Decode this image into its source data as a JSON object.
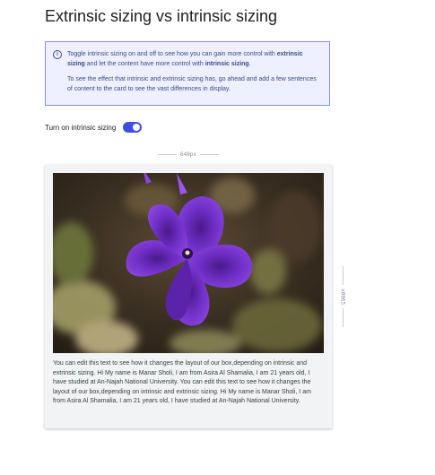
{
  "page": {
    "title": "Extrinsic sizing vs intrinsic sizing"
  },
  "info": {
    "p1_a": "Toggle intrinsic sizing on and off to see how you can gain more control with ",
    "p1_b": "extrinsic sizing",
    "p1_c": " and let the content have more control with ",
    "p1_d": "intrinsic sizing",
    "p1_e": ".",
    "p2": "To see the effect that intrinsic and extrinsic sizing has, go ahead and add a few sentences of content to the card to see the vast differences in display."
  },
  "toggle": {
    "label": "Turn on intrinsic sizing",
    "on": true
  },
  "dimensions": {
    "width_label": "640px",
    "height_label": "x0965"
  },
  "card": {
    "text": "You can edit this text to see how it changes the layout of our box,depending on intrinsic and extrinsic sizing. Hi My name is Manar Sholi, I am from Asira Al Shamalia, I am 21 years old, I have studied at An-Najah National University. You can edit this text to see how it changes the layout of our box,depending on intrinsic and extrinsic sizing. Hi My name is Manar Sholi, I am from Asira Al Shamalia, I am 21 years old, I have studied at An-Najah National University."
  },
  "colors": {
    "accent": "#3d4ee0",
    "info_bg": "#eef0ff",
    "info_border": "#8a8df0",
    "card_bg": "#f1f3f4"
  }
}
